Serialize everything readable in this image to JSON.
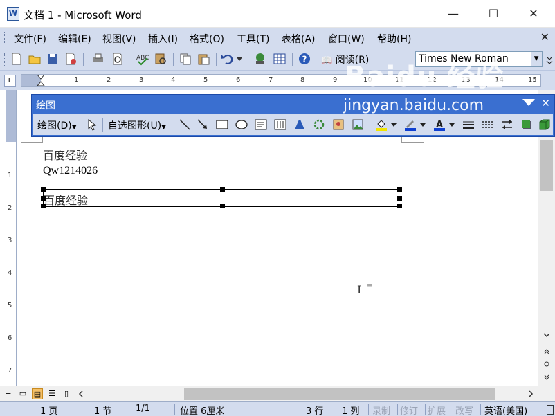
{
  "window": {
    "title": "文档 1 - Microsoft Word",
    "app_icon_letter": "W",
    "minimize_glyph": "—",
    "maximize_glyph": "☐",
    "close_glyph": "✕"
  },
  "menu": {
    "items": [
      "文件(F)",
      "编辑(E)",
      "视图(V)",
      "插入(I)",
      "格式(O)",
      "工具(T)",
      "表格(A)",
      "窗口(W)",
      "帮助(H)"
    ],
    "close_doc_glyph": "✕"
  },
  "toolbar": {
    "icons": [
      "new-document-icon",
      "open-folder-icon",
      "save-icon",
      "permission-icon",
      "print-icon",
      "print-preview-icon",
      "spelling-icon",
      "research-icon",
      "copy-icon",
      "paste-icon",
      "undo-icon",
      "hyperlink-icon",
      "table-icon",
      "help-icon"
    ],
    "read_label": "阅读(R)",
    "font_name": "Times New Roman"
  },
  "ruler": {
    "numbers": [
      "1",
      "2",
      "3",
      "4",
      "5",
      "6",
      "7",
      "8",
      "9",
      "10",
      "11",
      "12",
      "13",
      "14",
      "15"
    ],
    "tab_glyph": "L"
  },
  "vruler": {
    "numbers": [
      "1",
      "2",
      "3",
      "4",
      "5",
      "6",
      "7"
    ]
  },
  "drawing_toolbar": {
    "title": "绘图",
    "draw_menu": "绘图(D)",
    "autoshapes_menu": "自选图形(U)",
    "close_glyph": "✕",
    "colors": {
      "fill": "#f2e600",
      "line": "#1040d0",
      "font": "#1040d0"
    }
  },
  "document": {
    "line1": "百度经验",
    "line2": "Qw1214026",
    "textbox_text": "百度经验",
    "para_mark": "≡"
  },
  "watermark": {
    "brand": "Baidu 经验",
    "url": "jingyan.baidu.com"
  },
  "statusbar": {
    "page": "1 页",
    "section": "1 节",
    "page_of": "1/1",
    "position": "位置 6厘米",
    "line": "3 行",
    "column": "1 列",
    "rec": "录制",
    "trk": "修订",
    "ext": "扩展",
    "ovr": "改写",
    "language": "英语(美国)"
  }
}
